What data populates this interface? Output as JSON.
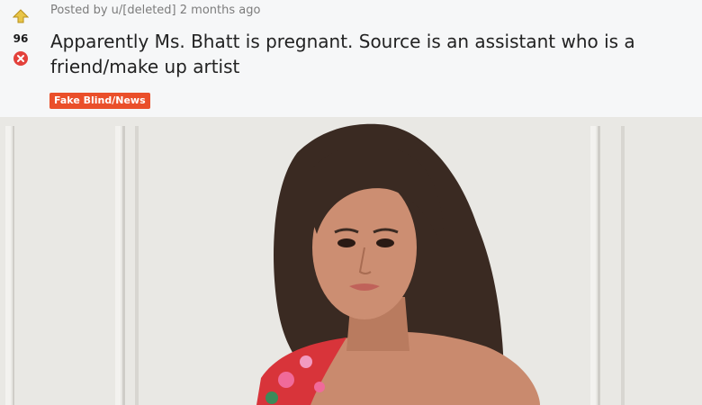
{
  "post": {
    "posted_by": "Posted by u/[deleted] 2 months ago",
    "score": "96",
    "title": "Apparently Ms. Bhatt is pregnant. Source is an assistant who is a friend/make up artist",
    "flair": "Fake Blind/News"
  },
  "icons": {
    "upvote": "upvote-arrow-icon",
    "downvote": "downvote-icon"
  },
  "colors": {
    "header_bg": "#f6f7f8",
    "flair_bg": "#ea4f2a",
    "upvote": "#d4a017",
    "downvote": "#e3413b",
    "meta_text": "#7c7c7c"
  }
}
